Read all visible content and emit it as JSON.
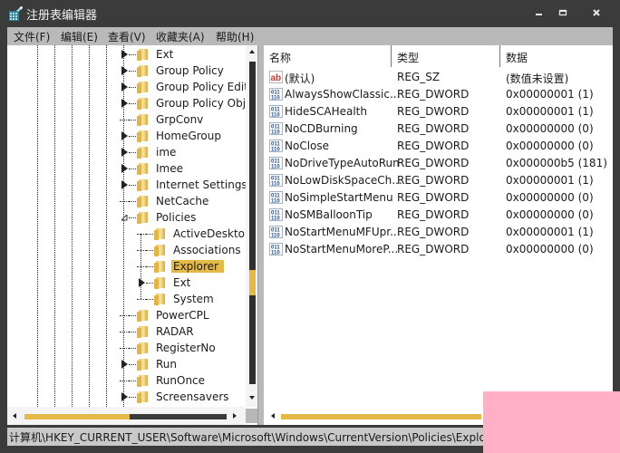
{
  "window": {
    "title": "注册表编辑器",
    "app_icon": "registry-editor-icon",
    "controls": [
      "minimize-icon",
      "maximize-icon",
      "close-icon"
    ]
  },
  "menubar": {
    "items": [
      {
        "label": "文件(F)"
      },
      {
        "label": "编辑(E)"
      },
      {
        "label": "查看(V)"
      },
      {
        "label": "收藏夹(A)"
      },
      {
        "label": "帮助(H)"
      }
    ]
  },
  "tree": {
    "items": [
      {
        "label": "Ext",
        "level": 0,
        "expander": "collapsed"
      },
      {
        "label": "Group Policy",
        "level": 0,
        "expander": "collapsed"
      },
      {
        "label": "Group Policy Editor",
        "level": 0,
        "expander": "collapsed"
      },
      {
        "label": "Group Policy Objec",
        "level": 0,
        "expander": "collapsed"
      },
      {
        "label": "GrpConv",
        "level": 0,
        "expander": "none"
      },
      {
        "label": "HomeGroup",
        "level": 0,
        "expander": "collapsed"
      },
      {
        "label": "ime",
        "level": 0,
        "expander": "collapsed"
      },
      {
        "label": "Imee",
        "level": 0,
        "expander": "collapsed"
      },
      {
        "label": "Internet Settings",
        "level": 0,
        "expander": "collapsed"
      },
      {
        "label": "NetCache",
        "level": 0,
        "expander": "none"
      },
      {
        "label": "Policies",
        "level": 0,
        "expander": "expanded"
      },
      {
        "label": "ActiveDesktop",
        "level": 1,
        "expander": "none"
      },
      {
        "label": "Associations",
        "level": 1,
        "expander": "none"
      },
      {
        "label": "Explorer",
        "level": 1,
        "expander": "none",
        "selected": true
      },
      {
        "label": "Ext",
        "level": 1,
        "expander": "collapsed"
      },
      {
        "label": "System",
        "level": 1,
        "expander": "none"
      },
      {
        "label": "PowerCPL",
        "level": 0,
        "expander": "none"
      },
      {
        "label": "RADAR",
        "level": 0,
        "expander": "none"
      },
      {
        "label": "RegisterNo",
        "level": 0,
        "expander": "none"
      },
      {
        "label": "Run",
        "level": 0,
        "expander": "collapsed"
      },
      {
        "label": "RunOnce",
        "level": 0,
        "expander": "none"
      },
      {
        "label": "Screensavers",
        "level": 0,
        "expander": "collapsed"
      }
    ]
  },
  "values_list": {
    "columns": [
      "名称",
      "类型",
      "数据"
    ],
    "rows": [
      {
        "icon": "string-value-icon",
        "name": "(默认)",
        "type": "REG_SZ",
        "data": "(数值未设置)"
      },
      {
        "icon": "binary-value-icon",
        "name": "AlwaysShowClassic...",
        "type": "REG_DWORD",
        "data": "0x00000001 (1)"
      },
      {
        "icon": "binary-value-icon",
        "name": "HideSCAHealth",
        "type": "REG_DWORD",
        "data": "0x00000001 (1)"
      },
      {
        "icon": "binary-value-icon",
        "name": "NoCDBurning",
        "type": "REG_DWORD",
        "data": "0x00000000 (0)"
      },
      {
        "icon": "binary-value-icon",
        "name": "NoClose",
        "type": "REG_DWORD",
        "data": "0x00000000 (0)"
      },
      {
        "icon": "binary-value-icon",
        "name": "NoDriveTypeAutoRun",
        "type": "REG_DWORD",
        "data": "0x000000b5 (181)"
      },
      {
        "icon": "binary-value-icon",
        "name": "NoLowDiskSpaceCh...",
        "type": "REG_DWORD",
        "data": "0x00000001 (1)"
      },
      {
        "icon": "binary-value-icon",
        "name": "NoSimpleStartMenu",
        "type": "REG_DWORD",
        "data": "0x00000000 (0)"
      },
      {
        "icon": "binary-value-icon",
        "name": "NoSMBalloonTip",
        "type": "REG_DWORD",
        "data": "0x00000000 (0)"
      },
      {
        "icon": "binary-value-icon",
        "name": "NoStartMenuMFUpr...",
        "type": "REG_DWORD",
        "data": "0x00000001 (1)"
      },
      {
        "icon": "binary-value-icon",
        "name": "NoStartMenuMoreP...",
        "type": "REG_DWORD",
        "data": "0x00000000 (0)"
      }
    ]
  },
  "statusbar": {
    "path": "计算机\\HKEY_CURRENT_USER\\Software\\Microsoft\\Windows\\CurrentVersion\\Policies\\Explorer"
  },
  "colors": {
    "titlebar": "#3b3b3b",
    "menubar": "#b9b9b9",
    "accent_gold": "#e4b947",
    "scroll_dark": "#2f2f2f",
    "statusbar": "#c9c9c9",
    "overlay_pink": "#ffafc6"
  }
}
